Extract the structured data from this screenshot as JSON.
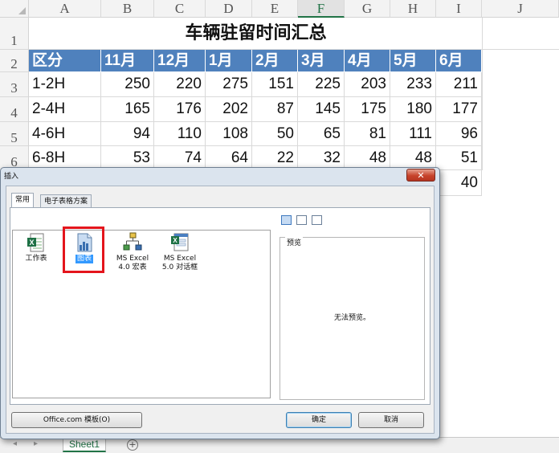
{
  "spreadsheet": {
    "columns": [
      "A",
      "B",
      "C",
      "D",
      "E",
      "F",
      "G",
      "H",
      "I",
      "J"
    ],
    "selected_column": "F",
    "rows": [
      "1",
      "2",
      "3",
      "4",
      "5",
      "6"
    ],
    "title": "车辆驻留时间汇总",
    "header": [
      "区分",
      "11月",
      "12月",
      "1月",
      "2月",
      "3月",
      "4月",
      "5月",
      "6月"
    ],
    "data": [
      [
        "1-2H",
        "250",
        "220",
        "275",
        "151",
        "225",
        "203",
        "233",
        "211"
      ],
      [
        "2-4H",
        "165",
        "176",
        "202",
        "87",
        "145",
        "175",
        "180",
        "177"
      ],
      [
        "4-6H",
        "94",
        "110",
        "108",
        "50",
        "65",
        "81",
        "111",
        "96"
      ],
      [
        "6-8H",
        "53",
        "74",
        "64",
        "22",
        "32",
        "48",
        "48",
        "51"
      ]
    ],
    "partial_cell": "40",
    "header_color": "#4f81bd",
    "sheet_tab": "Sheet1",
    "add_sheet_symbol": "+",
    "nav_left": "◂",
    "nav_right": "▸"
  },
  "dialog": {
    "title": "插入",
    "close_symbol": "✕",
    "tabs": [
      "常用",
      "电子表格方案"
    ],
    "items": [
      {
        "label": "工作表",
        "icon": "excel-sheet-icon"
      },
      {
        "label": "图表",
        "icon": "chart-icon"
      },
      {
        "label": "MS Excel 4.0 宏表",
        "line1": "MS Excel",
        "line2": "4.0 宏表",
        "icon": "macro-sheet-icon"
      },
      {
        "label": "MS Excel 5.0 对话框",
        "line1": "MS Excel",
        "line2": "5.0 对话框",
        "icon": "dialog-sheet-icon"
      }
    ],
    "selected_item": "图表",
    "preview_label": "预览",
    "no_preview": "无法预览。",
    "office_button": "Office.com 模板(O)",
    "ok_button": "确定",
    "cancel_button": "取消",
    "highlight_color": "#e4151c"
  }
}
